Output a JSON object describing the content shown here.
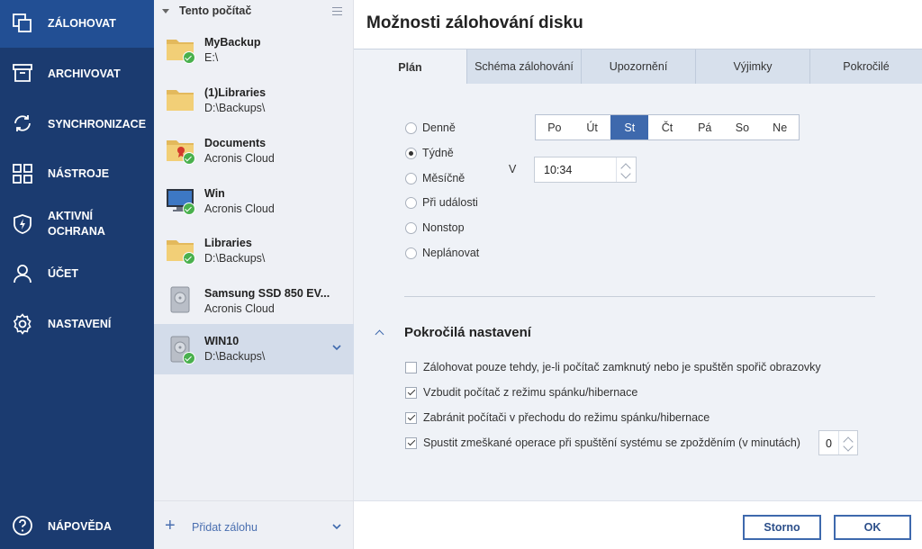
{
  "nav": {
    "items": [
      {
        "label": "ZÁLOHOVAT",
        "icon": "copy-icon"
      },
      {
        "label": "ARCHIVOVAT",
        "icon": "archive-box-icon"
      },
      {
        "label": "SYNCHRONIZACE",
        "icon": "sync-arrows-icon"
      },
      {
        "label": "NÁSTROJE",
        "icon": "grid-tools-icon"
      },
      {
        "label": "AKTIVNÍ",
        "label2": "OCHRANA",
        "icon": "shield-bolt-icon"
      },
      {
        "label": "ÚČET",
        "icon": "user-icon"
      },
      {
        "label": "NASTAVENÍ",
        "icon": "gear-icon"
      },
      {
        "label": "NÁPOVĚDA",
        "icon": "help-circle-icon"
      }
    ]
  },
  "list": {
    "header": "Tento počítač",
    "backups": [
      {
        "name": "MyBackup",
        "dest": "E:\\",
        "icon": "folder-icon"
      },
      {
        "name": "(1)Libraries",
        "dest": "D:\\Backups\\",
        "icon": "folder-icon"
      },
      {
        "name": "Documents",
        "dest": "Acronis Cloud",
        "icon": "cloud-folder-icon"
      },
      {
        "name": "Win",
        "dest": "Acronis Cloud",
        "icon": "monitor-icon"
      },
      {
        "name": "Libraries",
        "dest": "D:\\Backups\\",
        "icon": "folder-icon"
      },
      {
        "name": "Samsung SSD 850 EV...",
        "dest": "Acronis Cloud",
        "icon": "disk-icon"
      },
      {
        "name": "WIN10",
        "dest": "D:\\Backups\\",
        "icon": "disk-icon"
      }
    ],
    "add_label": "Přidat zálohu"
  },
  "main": {
    "title": "Možnosti zálohování disku",
    "tabs": [
      "Plán",
      "Schéma zálohování",
      "Upozornění",
      "Výjimky",
      "Pokročilé"
    ],
    "schedule_options": [
      "Denně",
      "Týdně",
      "Měsíčně",
      "Při události",
      "Nonstop",
      "Neplánovat"
    ],
    "selected_option": "Týdně",
    "days": [
      "Po",
      "Út",
      "St",
      "Čt",
      "Pá",
      "So",
      "Ne"
    ],
    "selected_day": "St",
    "time_label": "V",
    "time_value": "10:34",
    "advanced_title": "Pokročilá nastavení",
    "advanced_options": [
      {
        "label": "Zálohovat pouze tehdy, je-li počítač zamknutý nebo je spuštěn spořič obrazovky",
        "checked": false
      },
      {
        "label": "Vzbudit počítač z režimu spánku/hibernace",
        "checked": true
      },
      {
        "label": "Zabránit počítači v přechodu do režimu spánku/hibernace",
        "checked": true
      },
      {
        "label": "Spustit zmeškané operace při spuštění systému se zpožděním (v minutách)",
        "checked": true
      }
    ],
    "delay_minutes": "0",
    "cancel_label": "Storno",
    "ok_label": "OK"
  },
  "colors": {
    "nav_bg": "#1b3b70",
    "nav_active": "#224f94",
    "accent": "#3e69ad",
    "success": "#49b04d"
  }
}
